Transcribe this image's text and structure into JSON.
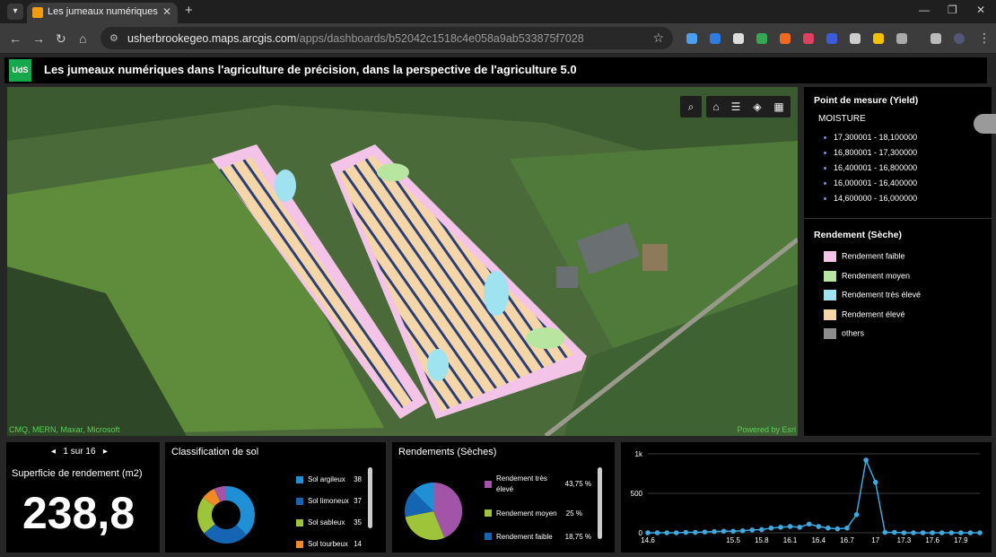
{
  "browser": {
    "tab_title": "Les jumeaux numériques dans l",
    "url_host": "usherbrookegeo.maps.arcgis.com",
    "url_path": "/apps/dashboards/b52042c1518c4e058a9ab533875f7028"
  },
  "header": {
    "logo_text": "UdS",
    "title": "Les jumeaux numériques dans l'agriculture de précision, dans la perspective de l'agriculture 5.0"
  },
  "map": {
    "attribution_left": "CMQ, MERN, Maxar, Microsoft",
    "attribution_right": "Powered by Esri"
  },
  "legend": {
    "layer1_title": "Point de mesure (Yield)",
    "layer1_field": "MOISTURE",
    "layer1_classes": [
      "17,300001 - 18,100000",
      "16,800001 - 17,300000",
      "16,400001 - 16,800000",
      "16,000001 - 16,400000",
      "14,600000 - 16,000000"
    ],
    "layer2_title": "Rendement (Sèche)",
    "layer2_classes": [
      {
        "label": "Rendement faible",
        "color": "#f3c3e8"
      },
      {
        "label": "Rendement moyen",
        "color": "#b8e6a0"
      },
      {
        "label": "Rendement très élevé",
        "color": "#9fe3f0"
      },
      {
        "label": "Rendement élevé",
        "color": "#f5d6a8"
      },
      {
        "label": "others",
        "color": "#8c8c8c"
      }
    ]
  },
  "indicator": {
    "pager": "1 sur 16",
    "label": "Superficie de rendement (m2)",
    "value": "238,8"
  },
  "soil_chart": {
    "title": "Classification de sol",
    "items": [
      {
        "label": "Sol argileux",
        "value": "38",
        "color": "#1f8fd6"
      },
      {
        "label": "Sol limoneux",
        "value": "37",
        "color": "#1565b3"
      },
      {
        "label": "Sol sableux",
        "value": "35",
        "color": "#9ec43a"
      },
      {
        "label": "Sol tourbeux",
        "value": "14",
        "color": "#f08a24"
      }
    ]
  },
  "yield_chart": {
    "title": "Rendements (Sèches)",
    "items": [
      {
        "label": "Rendement très élevé",
        "value": "43,75 %",
        "color": "#a254a8"
      },
      {
        "label": "Rendement moyen",
        "value": "25 %",
        "color": "#9ec43a"
      },
      {
        "label": "Rendement faible",
        "value": "18,75 %",
        "color": "#1565b3"
      }
    ]
  },
  "chart_data": {
    "type": "line",
    "x": [
      14.6,
      14.7,
      14.8,
      14.9,
      15.0,
      15.1,
      15.2,
      15.3,
      15.4,
      15.5,
      15.6,
      15.7,
      15.8,
      15.9,
      16.0,
      16.1,
      16.2,
      16.3,
      16.4,
      16.5,
      16.6,
      16.7,
      16.8,
      16.9,
      17.0,
      17.1,
      17.2,
      17.3,
      17.4,
      17.5,
      17.6,
      17.7,
      17.8,
      17.9,
      18.0,
      18.1
    ],
    "y": [
      0,
      0,
      0,
      0,
      5,
      5,
      10,
      15,
      20,
      20,
      25,
      35,
      40,
      60,
      70,
      80,
      70,
      110,
      80,
      60,
      50,
      60,
      230,
      920,
      640,
      5,
      5,
      0,
      0,
      0,
      0,
      0,
      0,
      0,
      0,
      0
    ],
    "x_ticks": [
      "14.6",
      "15.5",
      "15.8",
      "16.1",
      "16.4",
      "16.7",
      "17",
      "17.3",
      "17.6",
      "17.9"
    ],
    "y_ticks": [
      "1k",
      "500",
      "0"
    ],
    "ylim": [
      0,
      1000
    ]
  }
}
